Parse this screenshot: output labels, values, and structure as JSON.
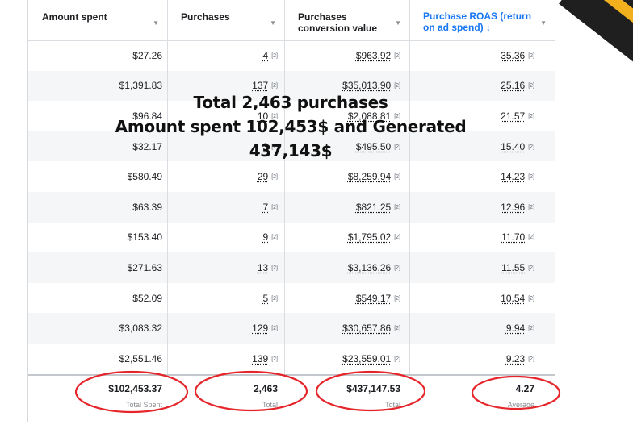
{
  "columns": [
    {
      "label": "Amount spent"
    },
    {
      "label": "Purchases"
    },
    {
      "label": "Purchases conversion value"
    },
    {
      "label": "Purchase ROAS (return on ad spend) ↓"
    }
  ],
  "rows": [
    {
      "amount": "$27.26",
      "purchases": "4",
      "value": "$963.92",
      "roas": "35.36"
    },
    {
      "amount": "$1,391.83",
      "purchases": "137",
      "value": "$35,013.90",
      "roas": "25.16"
    },
    {
      "amount": "$96.84",
      "purchases": "10",
      "value": "$2,088.81",
      "roas": "21.57"
    },
    {
      "amount": "$32.17",
      "purchases": "3",
      "value": "$495.50",
      "roas": "15.40"
    },
    {
      "amount": "$580.49",
      "purchases": "29",
      "value": "$8,259.94",
      "roas": "14.23"
    },
    {
      "amount": "$63.39",
      "purchases": "7",
      "value": "$821.25",
      "roas": "12.96"
    },
    {
      "amount": "$153.40",
      "purchases": "9",
      "value": "$1,795.02",
      "roas": "11.70"
    },
    {
      "amount": "$271.63",
      "purchases": "13",
      "value": "$3,136.26",
      "roas": "11.55"
    },
    {
      "amount": "$52.09",
      "purchases": "5",
      "value": "$549.17",
      "roas": "10.54"
    },
    {
      "amount": "$3,083.32",
      "purchases": "129",
      "value": "$30,657.86",
      "roas": "9.94"
    },
    {
      "amount": "$2,551.46",
      "purchases": "139",
      "value": "$23,559.01",
      "roas": "9.23"
    }
  ],
  "totals": [
    {
      "value": "$102,453.37",
      "label": "Total Spent"
    },
    {
      "value": "2,463",
      "label": "Total"
    },
    {
      "value": "$437,147.53",
      "label": "Total"
    },
    {
      "value": "4.27",
      "label": "Average"
    }
  ],
  "overlay": {
    "line1": "Total 2,463 purchases",
    "line2": "Amount spent 102,453$ and Generated",
    "line3": "437,143$"
  },
  "icons": {
    "info": "info-icon",
    "sort": "sort-icon"
  },
  "colors": {
    "accent": "#1877f2",
    "circle": "#e5252a",
    "corner_dark": "#1f1f1f",
    "corner_stripe": "#f2b01e"
  }
}
